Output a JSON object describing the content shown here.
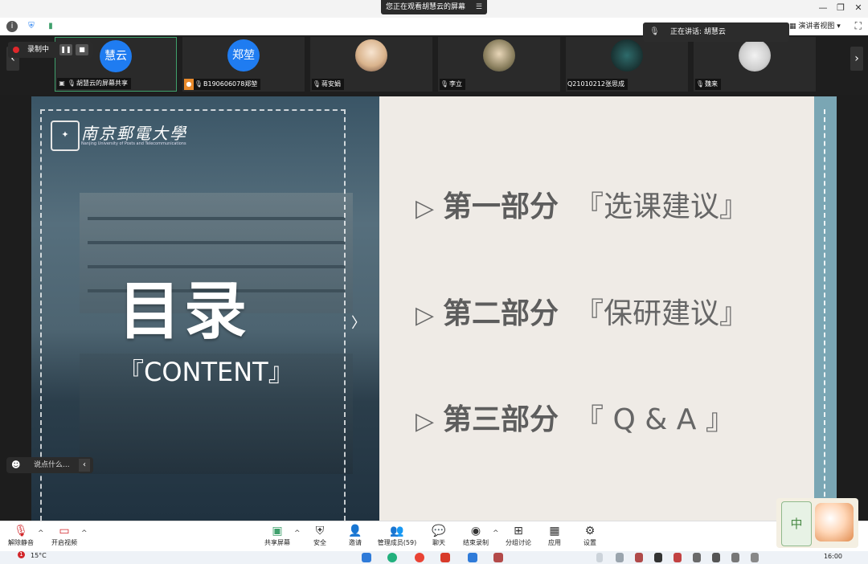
{
  "window": {
    "viewing_banner": "您正在观看胡慧云的屏幕",
    "speaking_prefix": "正在讲话: ",
    "speaking_name": "胡慧云",
    "view_mode": "演讲者视图",
    "recording_label": "录制中"
  },
  "participants": [
    {
      "avatar_text": "慧云",
      "label": "胡慧云的屏幕共享",
      "type": "text",
      "color": "#1f7cf1"
    },
    {
      "avatar_text": "郑堃",
      "label": "B190606078郑堃",
      "type": "text",
      "color": "#1f7cf1"
    },
    {
      "avatar_text": "",
      "label": "蒋安娟",
      "type": "photo",
      "color": "#d9b38c"
    },
    {
      "avatar_text": "",
      "label": "李立",
      "type": "photo",
      "color": "#8a7f5e"
    },
    {
      "avatar_text": "",
      "label": "Q21010212张思成",
      "type": "photo",
      "color": "#1c3a3a"
    },
    {
      "avatar_text": "",
      "label": "魏来",
      "type": "photo",
      "color": "#cfcfcf"
    }
  ],
  "slide": {
    "title": "目录",
    "subtitle": "『CONTENT』",
    "logo_name": "南京郵電大學",
    "logo_subtitle": "Nanjing University of Posts and Telecommunications",
    "toc": [
      {
        "head": "第一部分",
        "section": "『选课建议』"
      },
      {
        "head": "第二部分",
        "section": "『保研建议』"
      },
      {
        "head": "第三部分",
        "section": "『 Q & A 』"
      }
    ]
  },
  "chat": {
    "placeholder": "说点什么..."
  },
  "controls": {
    "unmute": "解除静音",
    "start_video": "开启视频",
    "share_screen": "共享屏幕",
    "security": "安全",
    "invite": "邀请",
    "manage_members": "管理成员(59)",
    "chat": "聊天",
    "stop_recording": "结束录制",
    "breakout": "分组讨论",
    "apps": "应用",
    "settings": "设置"
  },
  "sticker": {
    "text": "中"
  },
  "taskbar": {
    "temperature": "15°C",
    "badge": "1",
    "time": "16:00"
  }
}
